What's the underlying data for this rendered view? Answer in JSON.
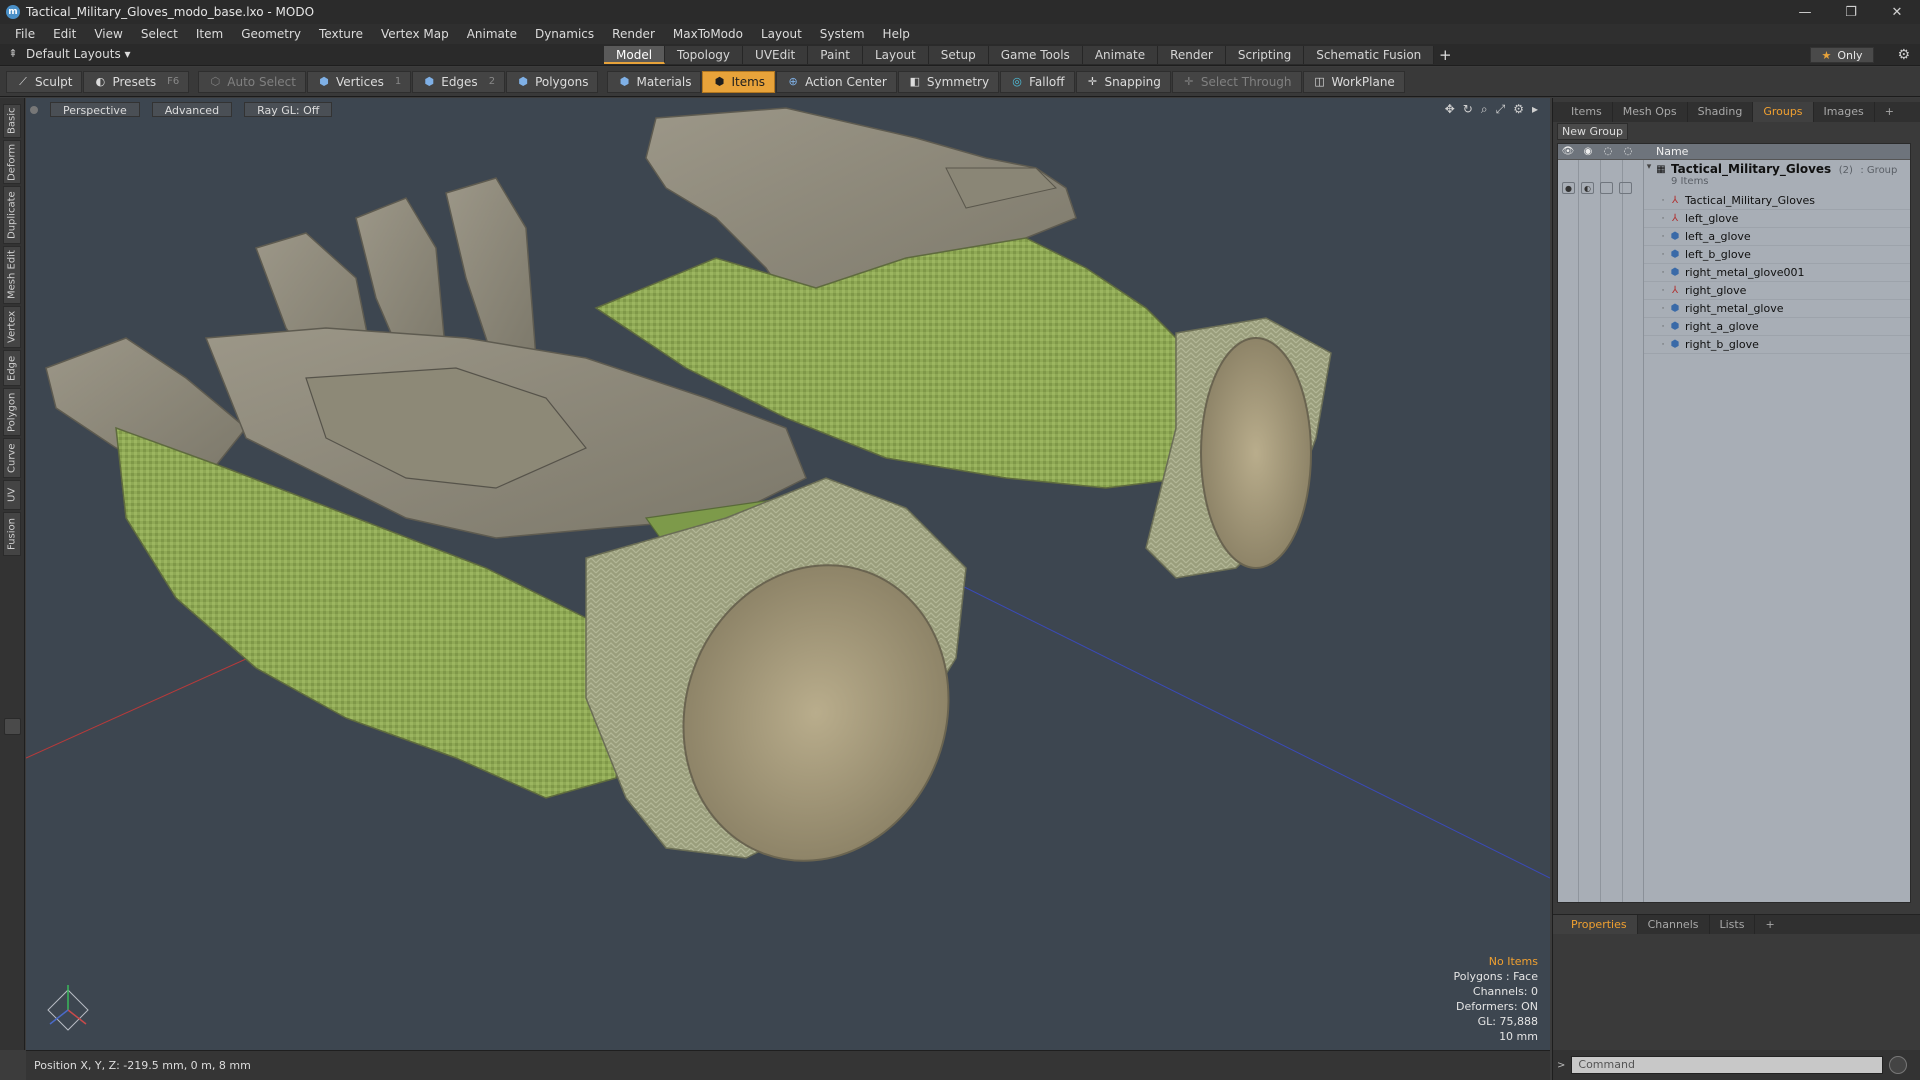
{
  "window": {
    "title": "Tactical_Military_Gloves_modo_base.lxo - MODO",
    "controls": [
      "—",
      "❐",
      "✕"
    ]
  },
  "menu": [
    "File",
    "Edit",
    "View",
    "Select",
    "Item",
    "Geometry",
    "Texture",
    "Vertex Map",
    "Animate",
    "Dynamics",
    "Render",
    "MaxToModo",
    "Layout",
    "System",
    "Help"
  ],
  "layout": {
    "name": "Default Layouts ▾",
    "tabs": [
      "Model",
      "Topology",
      "UVEdit",
      "Paint",
      "Layout",
      "Setup",
      "Game Tools",
      "Animate",
      "Render",
      "Scripting",
      "Schematic Fusion"
    ],
    "active_tab": "Model",
    "only_label": "Only"
  },
  "toolbar": {
    "sculpt": "Sculpt",
    "presets": "Presets",
    "presets_key": "F6",
    "auto_select": "Auto Select",
    "vertices": "Vertices",
    "vertices_num": "1",
    "edges": "Edges",
    "edges_num": "2",
    "polygons": "Polygons",
    "materials": "Materials",
    "items": "Items",
    "action_center": "Action Center",
    "symmetry": "Symmetry",
    "falloff": "Falloff",
    "snapping": "Snapping",
    "select_through": "Select Through",
    "workplane": "WorkPlane"
  },
  "left_tabs": [
    "Basic",
    "Deform",
    "Duplicate",
    "Mesh Edit",
    "Vertex",
    "Edge",
    "Polygon",
    "Curve",
    "UV",
    "Fusion"
  ],
  "viewport": {
    "view_mode": "Perspective",
    "shading": "Advanced",
    "raygl": "Ray GL: Off",
    "info": {
      "selection": "No Items",
      "polygons": "Polygons : Face",
      "channels": "Channels: 0",
      "deformers": "Deformers: ON",
      "gl": "GL: 75,888",
      "scale": "10 mm"
    },
    "colors": {
      "background": "#3d4650",
      "glove_leather": "#8c8878",
      "glove_fabric": "#8fa955",
      "axis_x": "#b83a3a",
      "axis_z": "#3a4ab8"
    }
  },
  "status": {
    "position": "Position X, Y, Z:  -219.5 mm, 0 m, 8 mm"
  },
  "right_panel": {
    "tabs": [
      "Items",
      "Mesh Ops",
      "Shading",
      "Groups",
      "Images"
    ],
    "active_tab": "Groups",
    "new_group": "New Group",
    "column_name": "Name",
    "group": {
      "name": "Tactical_Military_Gloves",
      "count": "(2)",
      "type": ": Group",
      "subtitle": "9 Items"
    },
    "items": [
      {
        "name": "Tactical_Military_Gloves",
        "icon": "locator-icon"
      },
      {
        "name": "left_glove",
        "icon": "locator-icon"
      },
      {
        "name": "left_a_glove",
        "icon": "mesh-icon"
      },
      {
        "name": "left_b_glove",
        "icon": "mesh-icon"
      },
      {
        "name": "right_metal_glove001",
        "icon": "mesh-icon"
      },
      {
        "name": "right_glove",
        "icon": "locator-icon"
      },
      {
        "name": "right_metal_glove",
        "icon": "mesh-icon"
      },
      {
        "name": "right_a_glove",
        "icon": "mesh-icon"
      },
      {
        "name": "right_b_glove",
        "icon": "mesh-icon"
      }
    ],
    "bottom_tabs": [
      "Properties",
      "Channels",
      "Lists"
    ],
    "bottom_active": "Properties",
    "command_placeholder": "Command"
  }
}
